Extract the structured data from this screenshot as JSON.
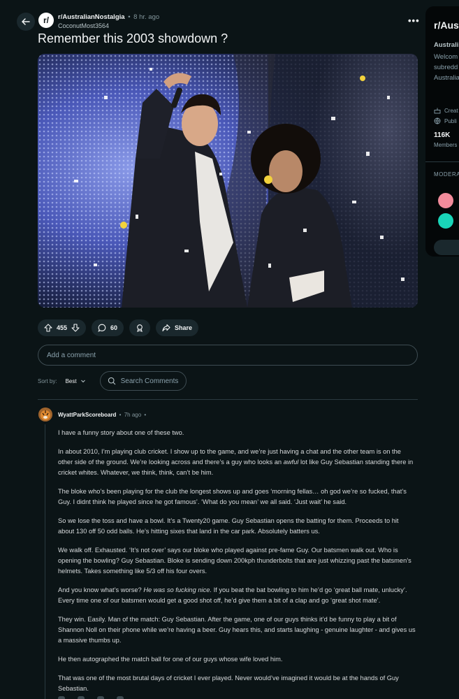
{
  "post": {
    "subreddit": "r/AustralianNostalgia",
    "subreddit_icon_text": "r/",
    "time": "8 hr. ago",
    "author": "CoconutMost3564",
    "title": "Remember this 2003 showdown ?",
    "upvotes": "455",
    "comments": "60",
    "share_label": "Share"
  },
  "comment_box": {
    "placeholder": "Add a comment"
  },
  "sort": {
    "label": "Sort by:",
    "value": "Best",
    "search_placeholder": "Search Comments"
  },
  "comment": {
    "author": "WyattParkScoreboard",
    "time": "7h ago",
    "p1": "I have a funny story about one of these two.",
    "p2a": "In about 2010, I’m playing club cricket. I show up to the game, and we’re just having a chat and the other team is on the other side of the ground. We’re looking across and there’s a guy who looks an ",
    "p2em": "awful",
    "p2b": " lot like Guy Sebastian standing there in cricket whites. Whatever, we think, think, can’t be him.",
    "p3": "The bloke who’s been playing for the club the longest shows up and goes ‘morning fellas… oh god we’re so fucked, that’s Guy. I didnt think he played since he got famous’. ‘What do you mean’ we all said. ‘Just wait’ he said.",
    "p4": "So we lose the toss and have a bowl. It’s a Twenty20 game. Guy Sebastian opens the batting for them. Proceeds to hit about 130 off 50 odd balls. He’s hitting sixes that land in the car park. Absolutely batters us.",
    "p5": "We walk off. Exhausted. ‘It’s not over’ says our bloke who played against pre-fame Guy. Our batsmen walk out. Who is opening the bowling? Guy Sebastian. Bloke is sending down 200kph thunderbolts that are just whizzing past the batsmen’s helmets. Takes something like 5/3 off his four overs.",
    "p6a": "And you know what’s worse? ",
    "p6em": "He was so fucking nice.",
    "p6b": " If you beat the bat bowling to him he’d go ‘great ball mate, unlucky’. Every time one of our batsmen would get a good shot off, he’d give them a bit of a clap and go ‘great shot mate’.",
    "p7": "They win. Easily. Man of the match: Guy Sebastian. After the game, one of our guys thinks it’d be funny to play a bit of Shannon Noll on their phone while we’re having a beer. Guy hears this, and starts laughing - genuine laughter - and gives us a massive thumbs up.",
    "p8": "He then autographed the match ball for one of our guys whose wife loved him.",
    "p9": "That was one of the most brutal days of cricket I ever played. Never would’ve imagined it would be at the hands of Guy Sebastian."
  },
  "sidebar": {
    "title": "r/Austr",
    "name": "Australi",
    "desc1": "Welcom",
    "desc2": "subredd",
    "desc3": "Australia",
    "created": "Creat",
    "public": "Publi",
    "members": "116K",
    "members_label": "Members",
    "moderators": "MODERA"
  },
  "colors": {
    "background": "#0b1416",
    "pill": "#1a282d",
    "border": "#3e4c52",
    "mod1": "#f28b9b",
    "mod2": "#19d5b8"
  }
}
